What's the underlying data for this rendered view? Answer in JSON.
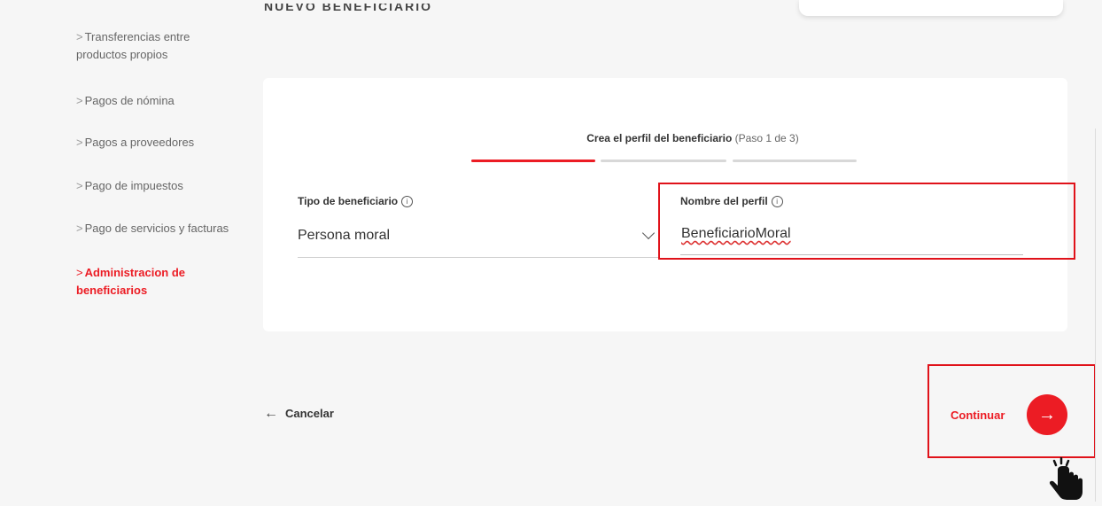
{
  "header": {
    "title": "NUEVO BENEFICIARIO"
  },
  "sidebar": {
    "items": [
      {
        "chevron": ">",
        "line1": "Transferencias entre",
        "line2": "productos propios"
      },
      {
        "chevron": ">",
        "line1": "Pagos de nómina"
      },
      {
        "chevron": ">",
        "line1": "Pagos a proveedores"
      },
      {
        "chevron": ">",
        "line1": "Pago de impuestos"
      },
      {
        "chevron": ">",
        "line1": "Pago de servicios y facturas"
      },
      {
        "chevron": ">",
        "line1": "Administracion de",
        "line2": "beneficiarios",
        "active": true
      }
    ]
  },
  "stepper": {
    "title": "Crea el perfil del beneficiario",
    "subtitle": "(Paso 1 de 3)",
    "current_step": 1,
    "total_steps": 3
  },
  "form": {
    "tipo": {
      "label": "Tipo de beneficiario",
      "value": "Persona moral"
    },
    "nombre": {
      "label": "Nombre del perfil",
      "value": "BeneficiarioMoral"
    },
    "info_icon": "i"
  },
  "actions": {
    "cancel_arrow": "←",
    "cancel_label": "Cancelar",
    "continue_label": "Continuar",
    "continue_arrow": "→"
  },
  "colors": {
    "accent": "#ec1c24",
    "highlight_box": "#e0121a"
  },
  "icons": [
    "info-icon",
    "chevron-down-icon",
    "arrow-left-icon",
    "arrow-right-icon",
    "hand-pointer-icon"
  ]
}
